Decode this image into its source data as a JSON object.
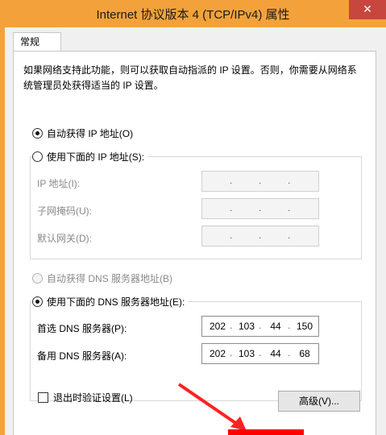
{
  "window": {
    "title": "Internet 协议版本 4 (TCP/IPv4) 属性",
    "close_label": "✕"
  },
  "tabs": [
    {
      "label": "常规"
    }
  ],
  "description": "如果网络支持此功能，则可以获取自动指派的 IP 设置。否则，你需要从网络系统管理员处获得适当的 IP 设置。",
  "ip_section": {
    "auto_label": "自动获得 IP 地址(O)",
    "manual_label": "使用下面的 IP 地址(S):",
    "selected": "auto",
    "fields": [
      {
        "label": "IP 地址(I):",
        "segments": [
          "",
          "",
          "",
          ""
        ]
      },
      {
        "label": "子网掩码(U):",
        "segments": [
          "",
          "",
          "",
          ""
        ]
      },
      {
        "label": "默认网关(D):",
        "segments": [
          "",
          "",
          "",
          ""
        ]
      }
    ]
  },
  "dns_section": {
    "auto_label": "自动获得 DNS 服务器地址(B)",
    "manual_label": "使用下面的 DNS 服务器地址(E):",
    "selected": "manual",
    "preferred": {
      "label": "首选 DNS 服务器(P):",
      "segments": [
        "202",
        "103",
        "44",
        "150"
      ]
    },
    "alternate": {
      "label": "备用 DNS 服务器(A):",
      "segments": [
        "202",
        "103",
        "44",
        "68"
      ]
    }
  },
  "validate_on_exit_label": "退出时验证设置(L)",
  "advanced_button_label": "高级(V)..."
}
